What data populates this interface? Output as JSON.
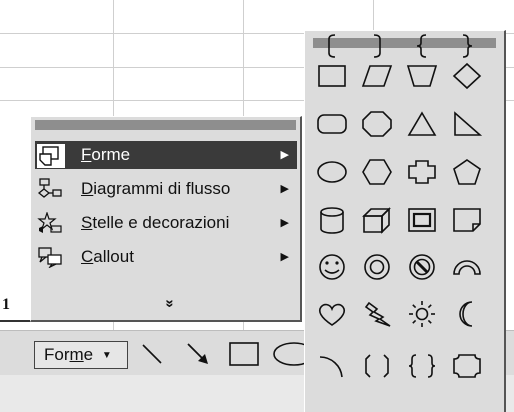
{
  "spreadsheet": {
    "row_number": "1"
  },
  "menu": {
    "items": [
      {
        "label_mnemonic": "F",
        "label_rest": "orme",
        "icon": "autoshape-icon",
        "active": true
      },
      {
        "label_mnemonic": "D",
        "label_rest": "iagrammi di flusso",
        "icon": "flowchart-icon",
        "active": false
      },
      {
        "label_mnemonic": "S",
        "label_rest": "telle e decorazioni",
        "icon": "stars-banners-icon",
        "active": false
      },
      {
        "label_mnemonic": "C",
        "label_rest": "allout",
        "icon": "callout-icon",
        "active": false
      }
    ],
    "expand_glyph": "»"
  },
  "toolbar": {
    "forme_label_pre": "For",
    "forme_label_mnemonic": "m",
    "forme_label_post": "e",
    "forme_arrow": "▼",
    "tools": [
      "line-icon",
      "arrow-icon",
      "rectangle-icon",
      "oval-icon"
    ]
  },
  "palette": {
    "shapes": [
      "rectangle",
      "parallelogram",
      "trapezoid",
      "diamond",
      "rounded-rectangle",
      "octagon",
      "isosceles-triangle",
      "right-triangle",
      "oval",
      "hexagon",
      "cross",
      "pentagon",
      "can",
      "cube",
      "bevel",
      "folded-corner",
      "smiley-face",
      "donut",
      "no-symbol",
      "block-arc",
      "heart",
      "lightning-bolt",
      "sun",
      "moon",
      "arc",
      "double-bracket",
      "double-brace",
      "plaque",
      "left-bracket",
      "right-bracket",
      "left-brace",
      "right-brace"
    ]
  },
  "colors": {
    "menu_bg": "#dcdcdc",
    "highlight": "#3a3a3a",
    "titlebar": "#8e8e8e"
  }
}
